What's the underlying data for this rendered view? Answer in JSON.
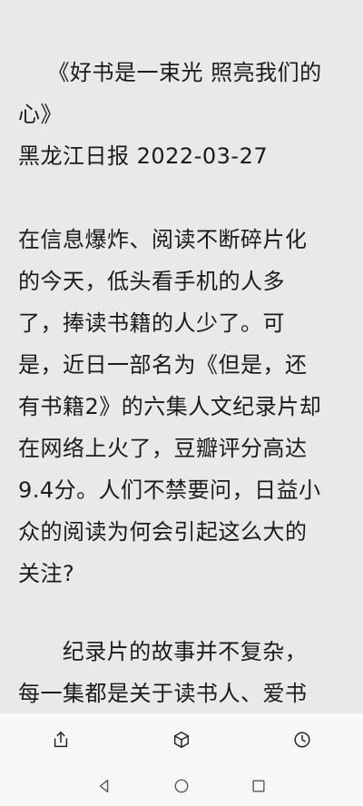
{
  "article": {
    "lines": [
      "    《好书是一束光 照亮我们的",
      "心》",
      "黑龙江日报 2022-03-27",
      "",
      "在信息爆炸、阅读不断碎片化",
      "的今天，低头看手机的人多",
      "了，捧读书籍的人少了。可",
      "是，近日一部名为《但是，还",
      "有书籍2》的六集人文纪录片却",
      "在网络上火了，豆瓣评分高达",
      "9.4分。人们不禁要问，日益小",
      "众的阅读为何会引起这么大的",
      "关注?",
      "",
      "      纪录片的故事并不复杂，",
      "每一集都是关于读书人、爱书"
    ]
  },
  "toolbar": {
    "icons": [
      "share-icon",
      "cube-icon",
      "clock-icon"
    ]
  },
  "navbar": {
    "icons": [
      "back-icon",
      "home-icon",
      "recents-icon"
    ]
  }
}
